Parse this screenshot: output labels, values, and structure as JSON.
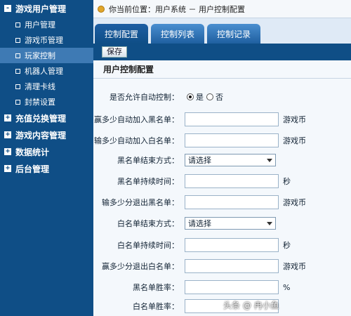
{
  "breadcrumb": "你当前位置：用户系统 － 用户控制配置",
  "sidebar": [
    {
      "type": "group",
      "symbol": "-",
      "label": "游戏用户管理"
    },
    {
      "type": "item",
      "label": "用户管理"
    },
    {
      "type": "item",
      "label": "游戏币管理"
    },
    {
      "type": "item",
      "label": "玩家控制",
      "active": true
    },
    {
      "type": "item",
      "label": "机器人管理"
    },
    {
      "type": "item",
      "label": "清理卡线"
    },
    {
      "type": "item",
      "label": "封禁设置"
    },
    {
      "type": "group",
      "symbol": "+",
      "label": "充值兑换管理"
    },
    {
      "type": "group",
      "symbol": "+",
      "label": "游戏内容管理"
    },
    {
      "type": "group",
      "symbol": "+",
      "label": "数据统计"
    },
    {
      "type": "group",
      "symbol": "+",
      "label": "后台管理"
    }
  ],
  "tabs": [
    "控制配置",
    "控制列表",
    "控制记录"
  ],
  "toolbar": {
    "save_label": "保存"
  },
  "panel_title": "用户控制配置",
  "form": {
    "auto_control": {
      "label": "是否允许自动控制：",
      "yes": "是",
      "no": "否"
    },
    "rows": [
      {
        "label": "赢多少自动加入黑名单：",
        "kind": "input",
        "unit": "游戏币"
      },
      {
        "label": "输多少自动加入白名单：",
        "kind": "input",
        "unit": "游戏币"
      },
      {
        "label": "黑名单结束方式：",
        "kind": "select",
        "value": "请选择"
      },
      {
        "label": "黑名单持续时间：",
        "kind": "input",
        "unit": "秒"
      },
      {
        "label": "输多少分退出黑名单：",
        "kind": "input",
        "unit": "游戏币"
      },
      {
        "label": "白名单结束方式：",
        "kind": "select",
        "value": "请选择"
      },
      {
        "label": "白名单持续时间：",
        "kind": "input",
        "unit": "秒"
      },
      {
        "label": "赢多少分退出白名单：",
        "kind": "input",
        "unit": "游戏币"
      },
      {
        "label": "黑名单胜率：",
        "kind": "input",
        "unit": "%"
      },
      {
        "label": "白名单胜率：",
        "kind": "input",
        "unit": ""
      }
    ]
  },
  "watermark": "头条 @ 冉小鱼"
}
